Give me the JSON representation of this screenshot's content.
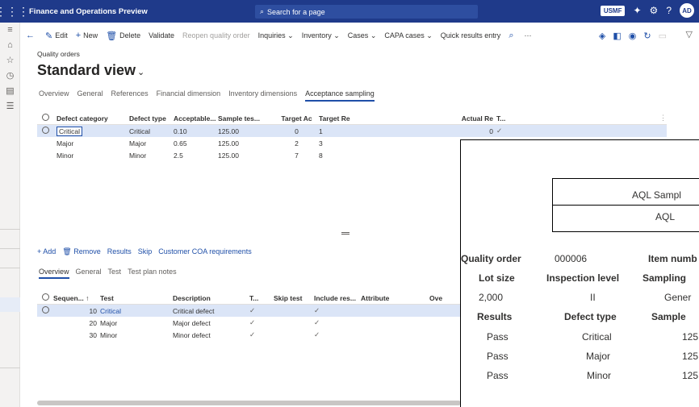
{
  "topbar": {
    "app_title": "Finance and Operations Preview",
    "search_placeholder": "Search for a page",
    "company": "USMF",
    "user_initials": "AD"
  },
  "actions": {
    "back": "←",
    "edit": "Edit",
    "new": "New",
    "delete": "Delete",
    "validate": "Validate",
    "reopen": "Reopen quality order",
    "inquiries": "Inquiries",
    "inventory": "Inventory",
    "cases": "Cases",
    "capa": "CAPA cases",
    "quick_results": "Quick results entry",
    "more": "···"
  },
  "page": {
    "breadcrumb": "Quality orders",
    "title": "Standard view"
  },
  "tabs": [
    "Overview",
    "General",
    "References",
    "Financial dimension",
    "Inventory dimensions",
    "Acceptance sampling"
  ],
  "grid1": {
    "headers": {
      "cat": "Defect category",
      "type": "Defect type",
      "acc": "Acceptable...",
      "samp": "Sample tes...",
      "tac": "Target Ac",
      "tre": "Target Re",
      "act": "Actual Re",
      "t": "T..."
    },
    "rows": [
      {
        "cat": "Critical",
        "type": "Critical",
        "acc": "0.10",
        "samp": "125.00",
        "tac": "0",
        "tre": "1",
        "act": "0",
        "t": "✓"
      },
      {
        "cat": "Major",
        "type": "Major",
        "acc": "0.65",
        "samp": "125.00",
        "tac": "2",
        "tre": "3",
        "act": "",
        "t": ""
      },
      {
        "cat": "Minor",
        "type": "Minor",
        "acc": "2.5",
        "samp": "125.00",
        "tac": "7",
        "tre": "8",
        "act": "",
        "t": ""
      }
    ]
  },
  "toolbar2": {
    "add": "Add",
    "remove": "Remove",
    "results": "Results",
    "skip": "Skip",
    "coa": "Customer COA requirements"
  },
  "tabs2": [
    "Overview",
    "General",
    "Test",
    "Test plan notes"
  ],
  "grid2": {
    "headers": {
      "seq": "Sequen...",
      "test": "Test",
      "desc": "Description",
      "t": "T...",
      "skip": "Skip test",
      "inc": "Include res...",
      "attr": "Attribute",
      "ove": "Ove"
    },
    "rows": [
      {
        "seq": "10",
        "test": "Critical",
        "desc": "Critical defect"
      },
      {
        "seq": "20",
        "test": "Major",
        "desc": "Major defect"
      },
      {
        "seq": "30",
        "test": "Minor",
        "desc": "Minor defect"
      }
    ]
  },
  "report": {
    "box_title": "AQL Sampl",
    "box_sub": "AQL",
    "quality_order_label": "Quality order",
    "quality_order_value": "000006",
    "item_number_label": "Item numb",
    "lot_size_label": "Lot size",
    "inspection_level_label": "Inspection level",
    "sampling_label": "Sampling",
    "lot_size_value": "2,000",
    "inspection_level_value": "II",
    "sampling_value": "Gener",
    "results_label": "Results",
    "defect_type_label": "Defect type",
    "sample_label": "Sample",
    "rows": [
      {
        "result": "Pass",
        "defect": "Critical",
        "sample": "125"
      },
      {
        "result": "Pass",
        "defect": "Major",
        "sample": "125"
      },
      {
        "result": "Pass",
        "defect": "Minor",
        "sample": "125"
      }
    ]
  }
}
